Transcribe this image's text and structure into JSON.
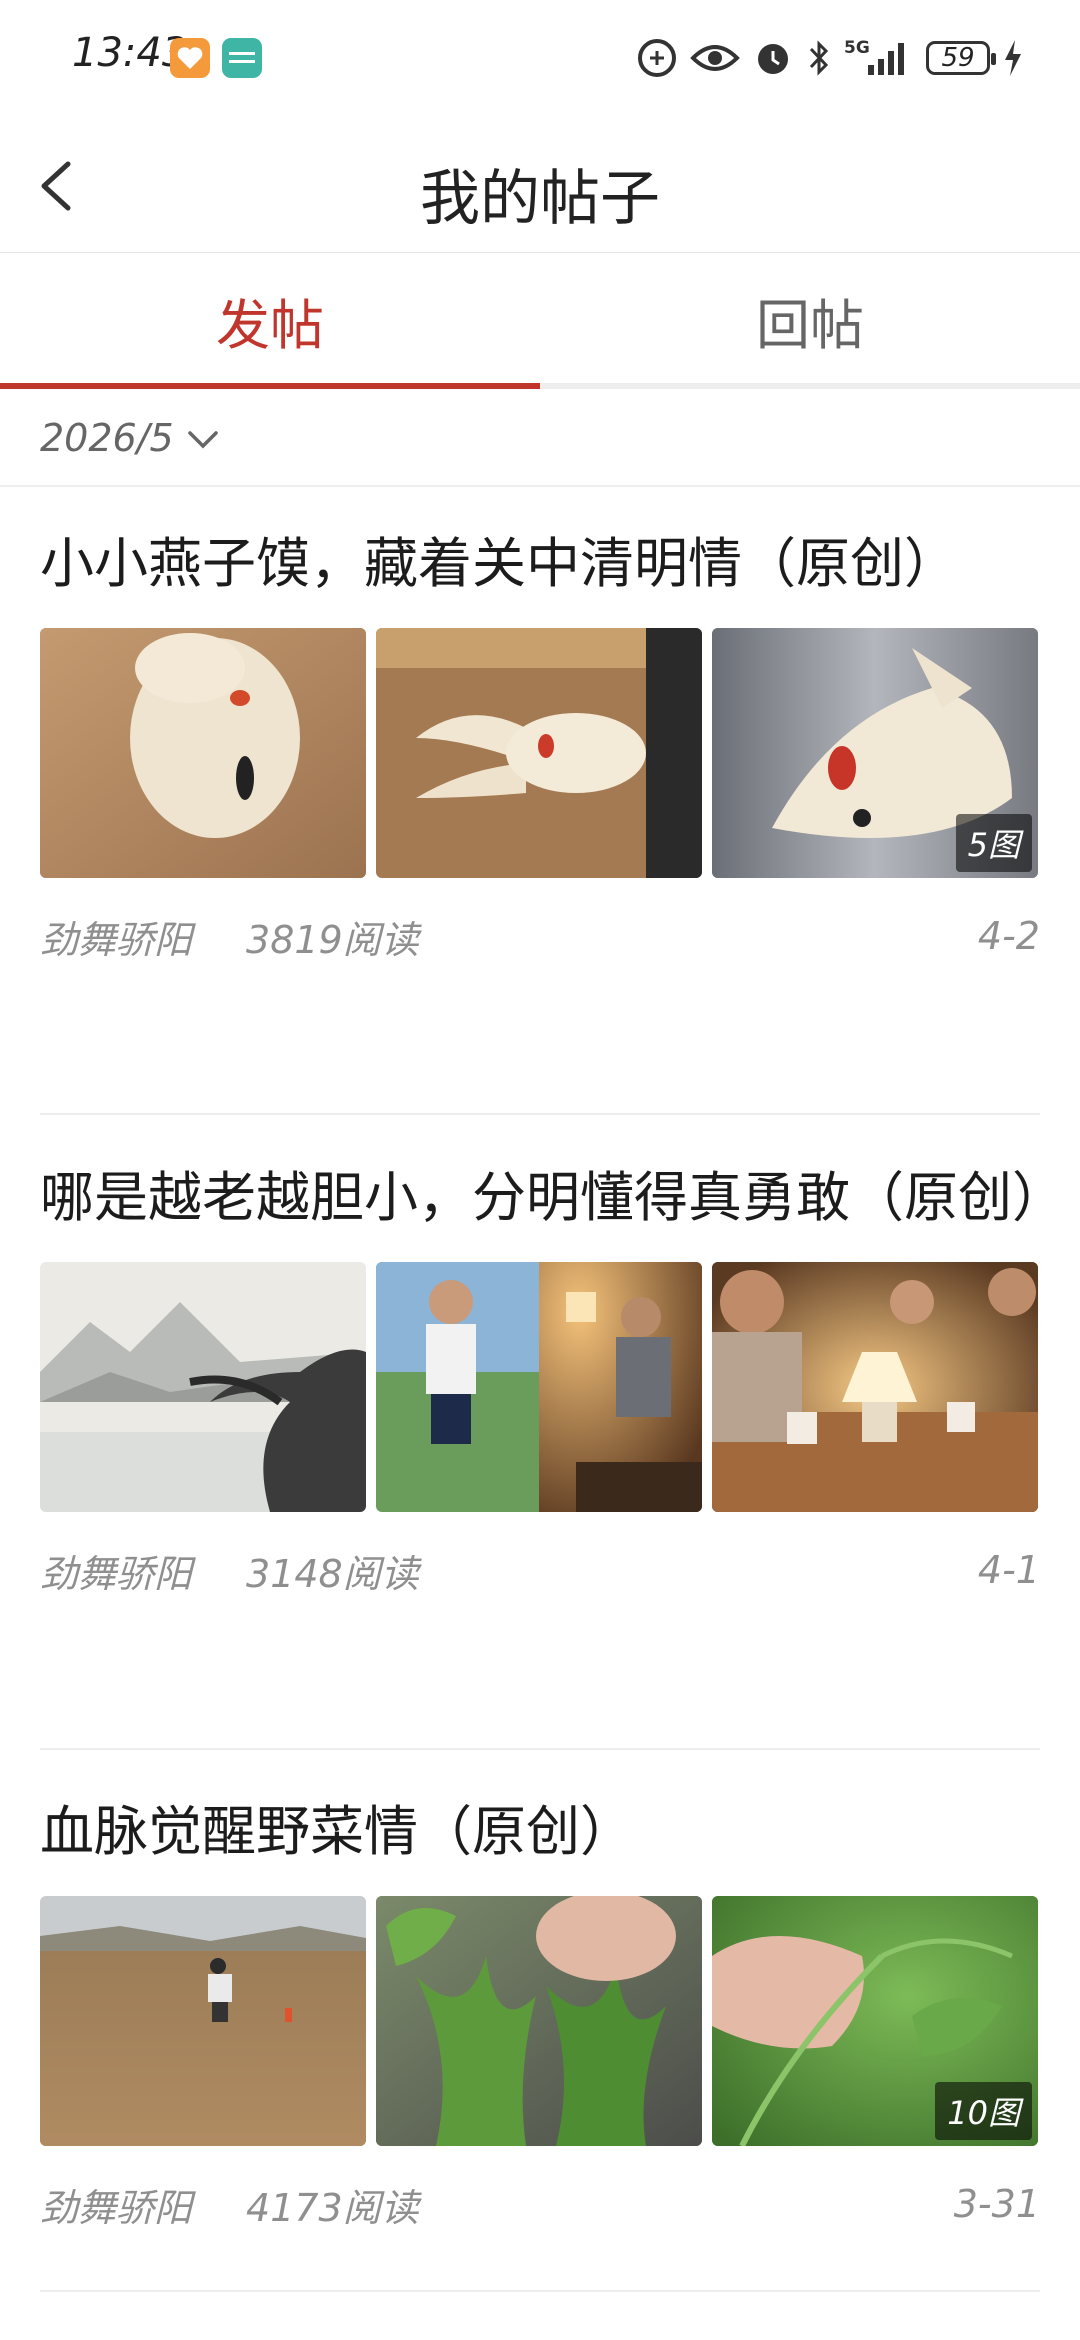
{
  "status_bar": {
    "time": "13:43",
    "app_icons": [
      "heart-app-icon",
      "boss-app-icon"
    ],
    "boss_label": "BOSS\n直聘",
    "network": "5G",
    "battery": "59"
  },
  "header": {
    "title": "我的帖子",
    "back_icon": "chevron-left-icon"
  },
  "tabs": [
    {
      "label": "发帖",
      "active": true
    },
    {
      "label": "回帖",
      "active": false
    }
  ],
  "filter": {
    "value": "2026/5",
    "icon": "chevron-down-icon"
  },
  "posts": [
    {
      "title": "小小燕子馍，藏着关中清明情（原创）",
      "images": [
        "steamed-bun-swallow-1",
        "steamed-bun-swallow-2",
        "steamed-bun-swallow-3"
      ],
      "image_count": "5图",
      "author": "劲舞骄阳",
      "reads": "3819阅读",
      "date": "4-2"
    },
    {
      "title": "哪是越老越胆小，分明懂得真勇敢（原创）",
      "images": [
        "ink-landscape-pine",
        "boy-running-and-elder-reading",
        "family-around-lamp"
      ],
      "image_count": "",
      "author": "劲舞骄阳",
      "reads": "3148阅读",
      "date": "4-1"
    },
    {
      "title": "血脉觉醒野菜情（原创）",
      "images": [
        "field-digging",
        "wild-greens-ground",
        "wild-greens-hand"
      ],
      "image_count": "10图",
      "author": "劲舞骄阳",
      "reads": "4173阅读",
      "date": "3-31"
    }
  ],
  "colors": {
    "accent": "#c0362c",
    "text_primary": "#1c1c1c",
    "text_meta": "#8f8f8f",
    "divider": "#eeeeee"
  }
}
